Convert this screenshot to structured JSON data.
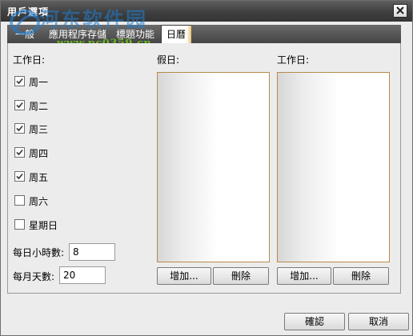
{
  "window": {
    "title": "用戶選項"
  },
  "watermark": {
    "site_name": "河东软件园",
    "url": "www.pc0359.cn"
  },
  "tabs": [
    {
      "label": "一般"
    },
    {
      "label": "應用程序存儲"
    },
    {
      "label": "標題功能"
    },
    {
      "label": "日曆",
      "active": true
    }
  ],
  "workdays": {
    "header": "工作日:",
    "days": [
      {
        "label": "周一",
        "checked": true
      },
      {
        "label": "周二",
        "checked": true
      },
      {
        "label": "周三",
        "checked": true
      },
      {
        "label": "周四",
        "checked": true
      },
      {
        "label": "周五",
        "checked": true
      },
      {
        "label": "周六",
        "checked": false
      },
      {
        "label": "星期日",
        "checked": false
      }
    ]
  },
  "hours_per_day": {
    "label": "每日小時數:",
    "value": "8"
  },
  "days_per_month": {
    "label": "每月天數:",
    "value": "20"
  },
  "holidays": {
    "header": "假日:",
    "add_label": "增加...",
    "delete_label": "刪除"
  },
  "extra_workdays": {
    "header": "工作日:",
    "add_label": "增加...",
    "delete_label": "刪除"
  },
  "footer": {
    "ok_label": "確認",
    "cancel_label": "取消"
  }
}
